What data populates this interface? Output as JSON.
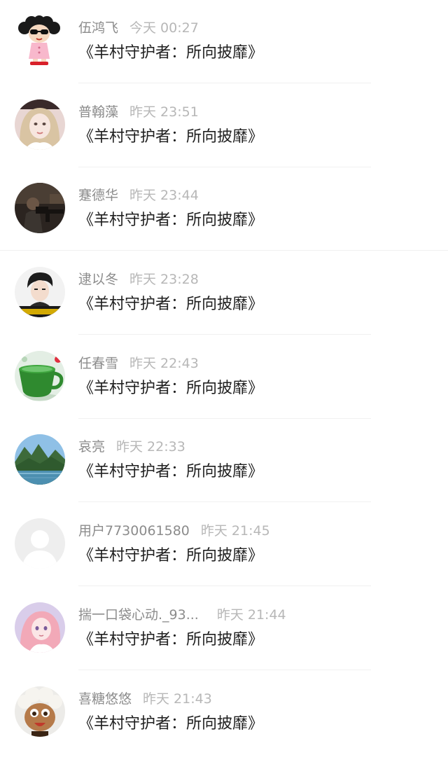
{
  "comments": [
    {
      "name": "伍鸿飞",
      "time": "今天 00:27",
      "content": "《羊村守护者：所向披靡》",
      "avatar_icon": "cartoon-girl-avatar-icon"
    },
    {
      "name": "普翰藻",
      "time": "昨天 23:51",
      "content": "《羊村守护者：所向披靡》",
      "avatar_icon": "photo-girl-avatar-icon"
    },
    {
      "name": "蹇德华",
      "time": "昨天 23:44",
      "content": "《羊村守护者：所向披靡》",
      "avatar_icon": "soldier-photo-avatar-icon"
    },
    {
      "name": "逮以冬",
      "time": "昨天 23:28",
      "content": "《羊村守护者：所向披靡》",
      "avatar_icon": "man-photo-avatar-icon"
    },
    {
      "name": "任春雪",
      "time": "昨天 22:43",
      "content": "《羊村守护者：所向披靡》",
      "avatar_icon": "green-cup-avatar-icon"
    },
    {
      "name": "哀亮",
      "time": "昨天 22:33",
      "content": "《羊村守护者：所向披靡》",
      "avatar_icon": "landscape-avatar-icon"
    },
    {
      "name": "用户7730061580",
      "time": "昨天 21:45",
      "content": "《羊村守护者：所向披靡》",
      "avatar_icon": "default-user-avatar-icon"
    },
    {
      "name": "揣一口袋心动._93...",
      "time": "昨天 21:44",
      "content": "《羊村守护者：所向披靡》",
      "avatar_icon": "anime-girl-avatar-icon"
    },
    {
      "name": "喜糖悠悠",
      "time": "昨天 21:43",
      "content": "《羊村守护者：所向披靡》",
      "avatar_icon": "cartoon-sheep-avatar-icon"
    }
  ]
}
